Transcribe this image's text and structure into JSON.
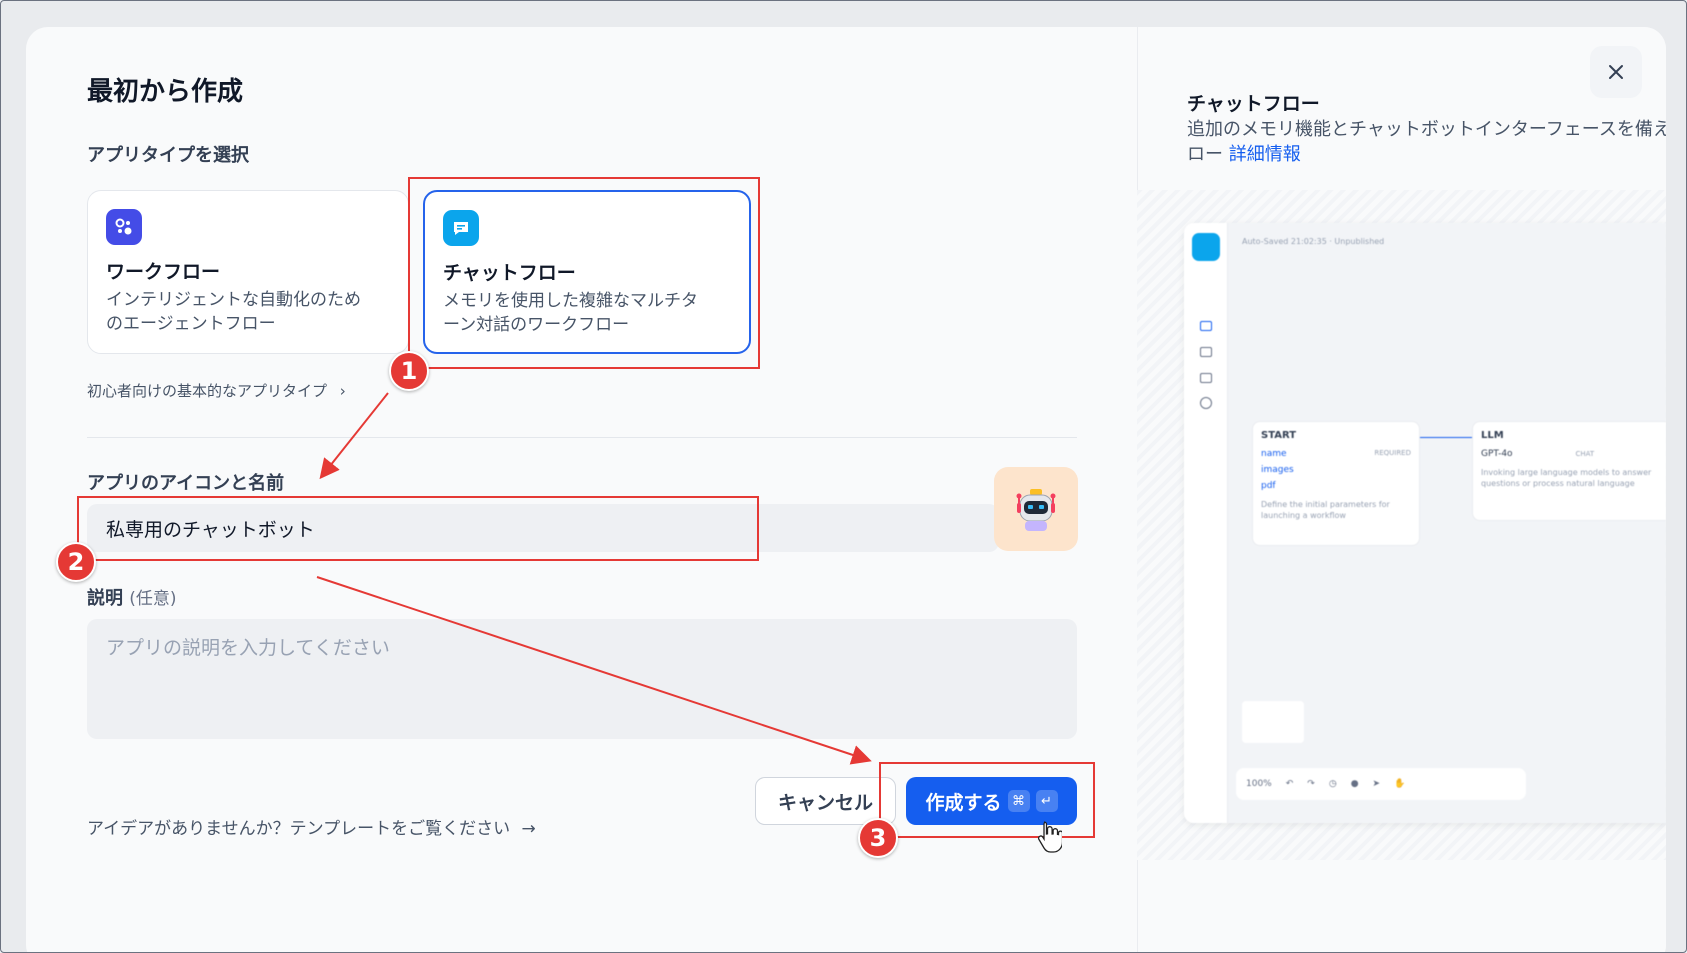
{
  "dialog": {
    "title": "最初から作成",
    "app_type_label": "アプリタイプを選択",
    "cards": [
      {
        "title": "ワークフロー",
        "desc_line1": "インテリジェントな自動化のため",
        "desc_line2": "のエージェントフロー"
      },
      {
        "title": "チャットフロー",
        "desc_line1": "メモリを使用した複雑なマルチタ",
        "desc_line2": "ーン対話のワークフロー"
      }
    ],
    "beginner_link": "初心者向けの基本的なアプリタイプ",
    "name_label": "アプリのアイコンと名前",
    "name_value": "私専用のチャットボット",
    "desc_label": "説明",
    "desc_optional": "(任意)",
    "desc_placeholder": "アプリの説明を入力してください",
    "template_link": "アイデアがありませんか？テンプレートをご覧ください",
    "cancel_label": "キャンセル",
    "create_label": "作成する",
    "create_kbd1": "⌘",
    "create_kbd2": "↵"
  },
  "preview_panel": {
    "title": "チャットフロー",
    "desc_line1": "追加のメモリ機能とチャットボットインターフェースを備え",
    "desc_line2_prefix": "ロー",
    "more_link": "詳細情報",
    "saved_text": "Auto-Saved 21:02:35 · Unpublished",
    "start_node": {
      "title": "START",
      "fields": [
        "name",
        "images",
        "pdf"
      ],
      "required": "REQUIRED",
      "desc": "Define the initial parameters for launching a workflow"
    },
    "llm_node": {
      "title": "LLM",
      "model": "GPT-4o",
      "mode": "CHAT",
      "desc": "Invoking large language models to answer questions or process natural language"
    },
    "zoom": "100%"
  },
  "annotations": [
    "1",
    "2",
    "3"
  ],
  "colors": {
    "accent": "#155eef",
    "annotation": "#e53935"
  }
}
